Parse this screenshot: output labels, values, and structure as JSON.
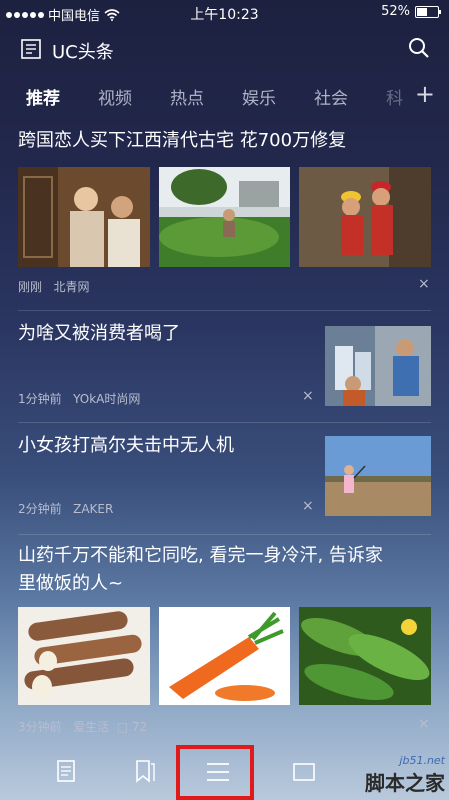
{
  "status": {
    "carrier": "中国电信",
    "time": "上午10:23",
    "battery": "52%",
    "battery_level": 0.52
  },
  "app": {
    "title": "UC头条"
  },
  "tabs": [
    "推荐",
    "视频",
    "热点",
    "娱乐",
    "社会",
    "科"
  ],
  "articles": [
    {
      "title": "跨国恋人买下江西清代古宅 花700万修复",
      "time": "刚刚",
      "source": "北青网"
    },
    {
      "title": "为啥又被消费者喝了",
      "time": "1分钟前",
      "source": "YOkA时尚网"
    },
    {
      "title": "小女孩打高尔夫击中无人机",
      "time": "2分钟前",
      "source": "ZAKER"
    },
    {
      "title_line1": "山药千万不能和它同吃, 看完一身冷汗, 告诉家",
      "title_line2": "里做饭的人~",
      "time": "3分钟前",
      "source": "爱生活",
      "comments": "72"
    }
  ],
  "icons": {
    "close": "×",
    "plus": "+"
  },
  "watermark": {
    "url": "jb51.net",
    "name": "脚本之家"
  },
  "colors": {
    "highlight": "#e01a1a"
  }
}
